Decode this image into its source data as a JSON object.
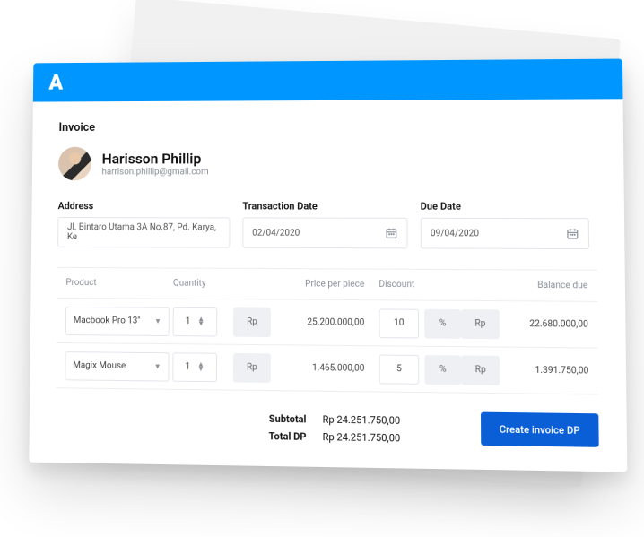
{
  "page": {
    "title": "Invoice"
  },
  "customer": {
    "name": "Harisson Phillip",
    "email": "harrison.phillip@gmail.com"
  },
  "fields": {
    "address": {
      "label": "Address",
      "value": "Jl. Bintaro Utama 3A No.87, Pd. Karya, Ke"
    },
    "transactionDate": {
      "label": "Transaction Date",
      "value": "02/04/2020"
    },
    "dueDate": {
      "label": "Due Date",
      "value": "09/04/2020"
    }
  },
  "table": {
    "headers": {
      "product": "Product",
      "quantity": "Quantity",
      "price": "Price per piece",
      "discount": "Discount",
      "balance": "Balance due"
    },
    "currency": "Rp",
    "percent": "%",
    "rows": [
      {
        "product": "Macbook Pro 13\"",
        "quantity": "1",
        "price": "25.200.000,00",
        "discount": "10",
        "balance": "22.680.000,00"
      },
      {
        "product": "Magix Mouse",
        "quantity": "1",
        "price": "1.465.000,00",
        "discount": "5",
        "balance": "1.391.750,00"
      }
    ]
  },
  "totals": {
    "subtotal": {
      "label": "Subtotal",
      "value": "Rp 24.251.750,00"
    },
    "totalDp": {
      "label": "Total DP",
      "value": "Rp 24.251.750,00"
    }
  },
  "actions": {
    "createInvoice": "Create invoice DP"
  },
  "brand": {
    "logo": "A"
  }
}
